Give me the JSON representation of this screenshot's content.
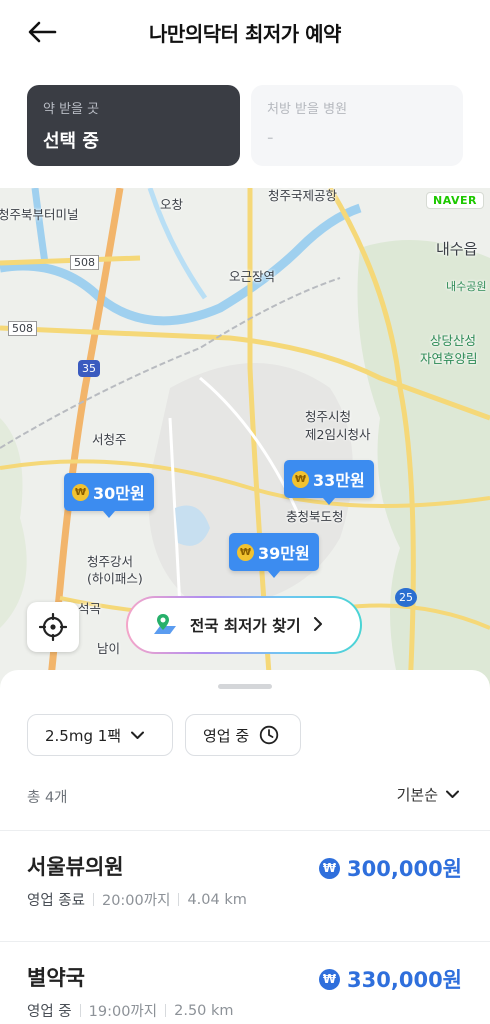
{
  "header": {
    "title": "나만의닥터 최저가 예약",
    "back_icon": "arrow-left-icon"
  },
  "selectors": {
    "pickup": {
      "label": "약 받을 곳",
      "value": "선택 중"
    },
    "hospital": {
      "label": "처방 받을 병원",
      "value": "-"
    }
  },
  "map": {
    "provider_badge": "NAVER",
    "labels": [
      "청주국제공항",
      "오창",
      "청주북부터미널",
      "내수읍",
      "내수공원",
      "오근장역",
      "상당산성",
      "자연휴양림",
      "청주시청",
      "제2임시청사",
      "서청주",
      "충청북도청",
      "청주강서",
      "(하이패스)",
      "남이",
      "석곡"
    ],
    "route_badges": [
      "508",
      "508",
      "35",
      "25"
    ],
    "markers": [
      {
        "price": "30만원"
      },
      {
        "price": "33만원"
      },
      {
        "price": "39만원"
      }
    ],
    "locate_icon": "crosshair-icon",
    "find_button": {
      "label": "전국 최저가 찾기",
      "icon": "map-pin-icon"
    }
  },
  "filters": {
    "dose": "2.5mg 1팩",
    "status": "영업 중"
  },
  "list": {
    "total": "총 4개",
    "sort": "기본순",
    "items": [
      {
        "name": "서울뷰의원",
        "status": "영업 종료",
        "hours": "20:00까지",
        "distance": "4.04 km",
        "price": "300,000원"
      },
      {
        "name": "별약국",
        "status": "영업 중",
        "hours": "19:00까지",
        "distance": "2.50 km",
        "price": "330,000원"
      }
    ]
  },
  "colors": {
    "accent": "#3c8cf0",
    "price_text": "#2f6fdc",
    "card_dark": "#3a3d44"
  }
}
